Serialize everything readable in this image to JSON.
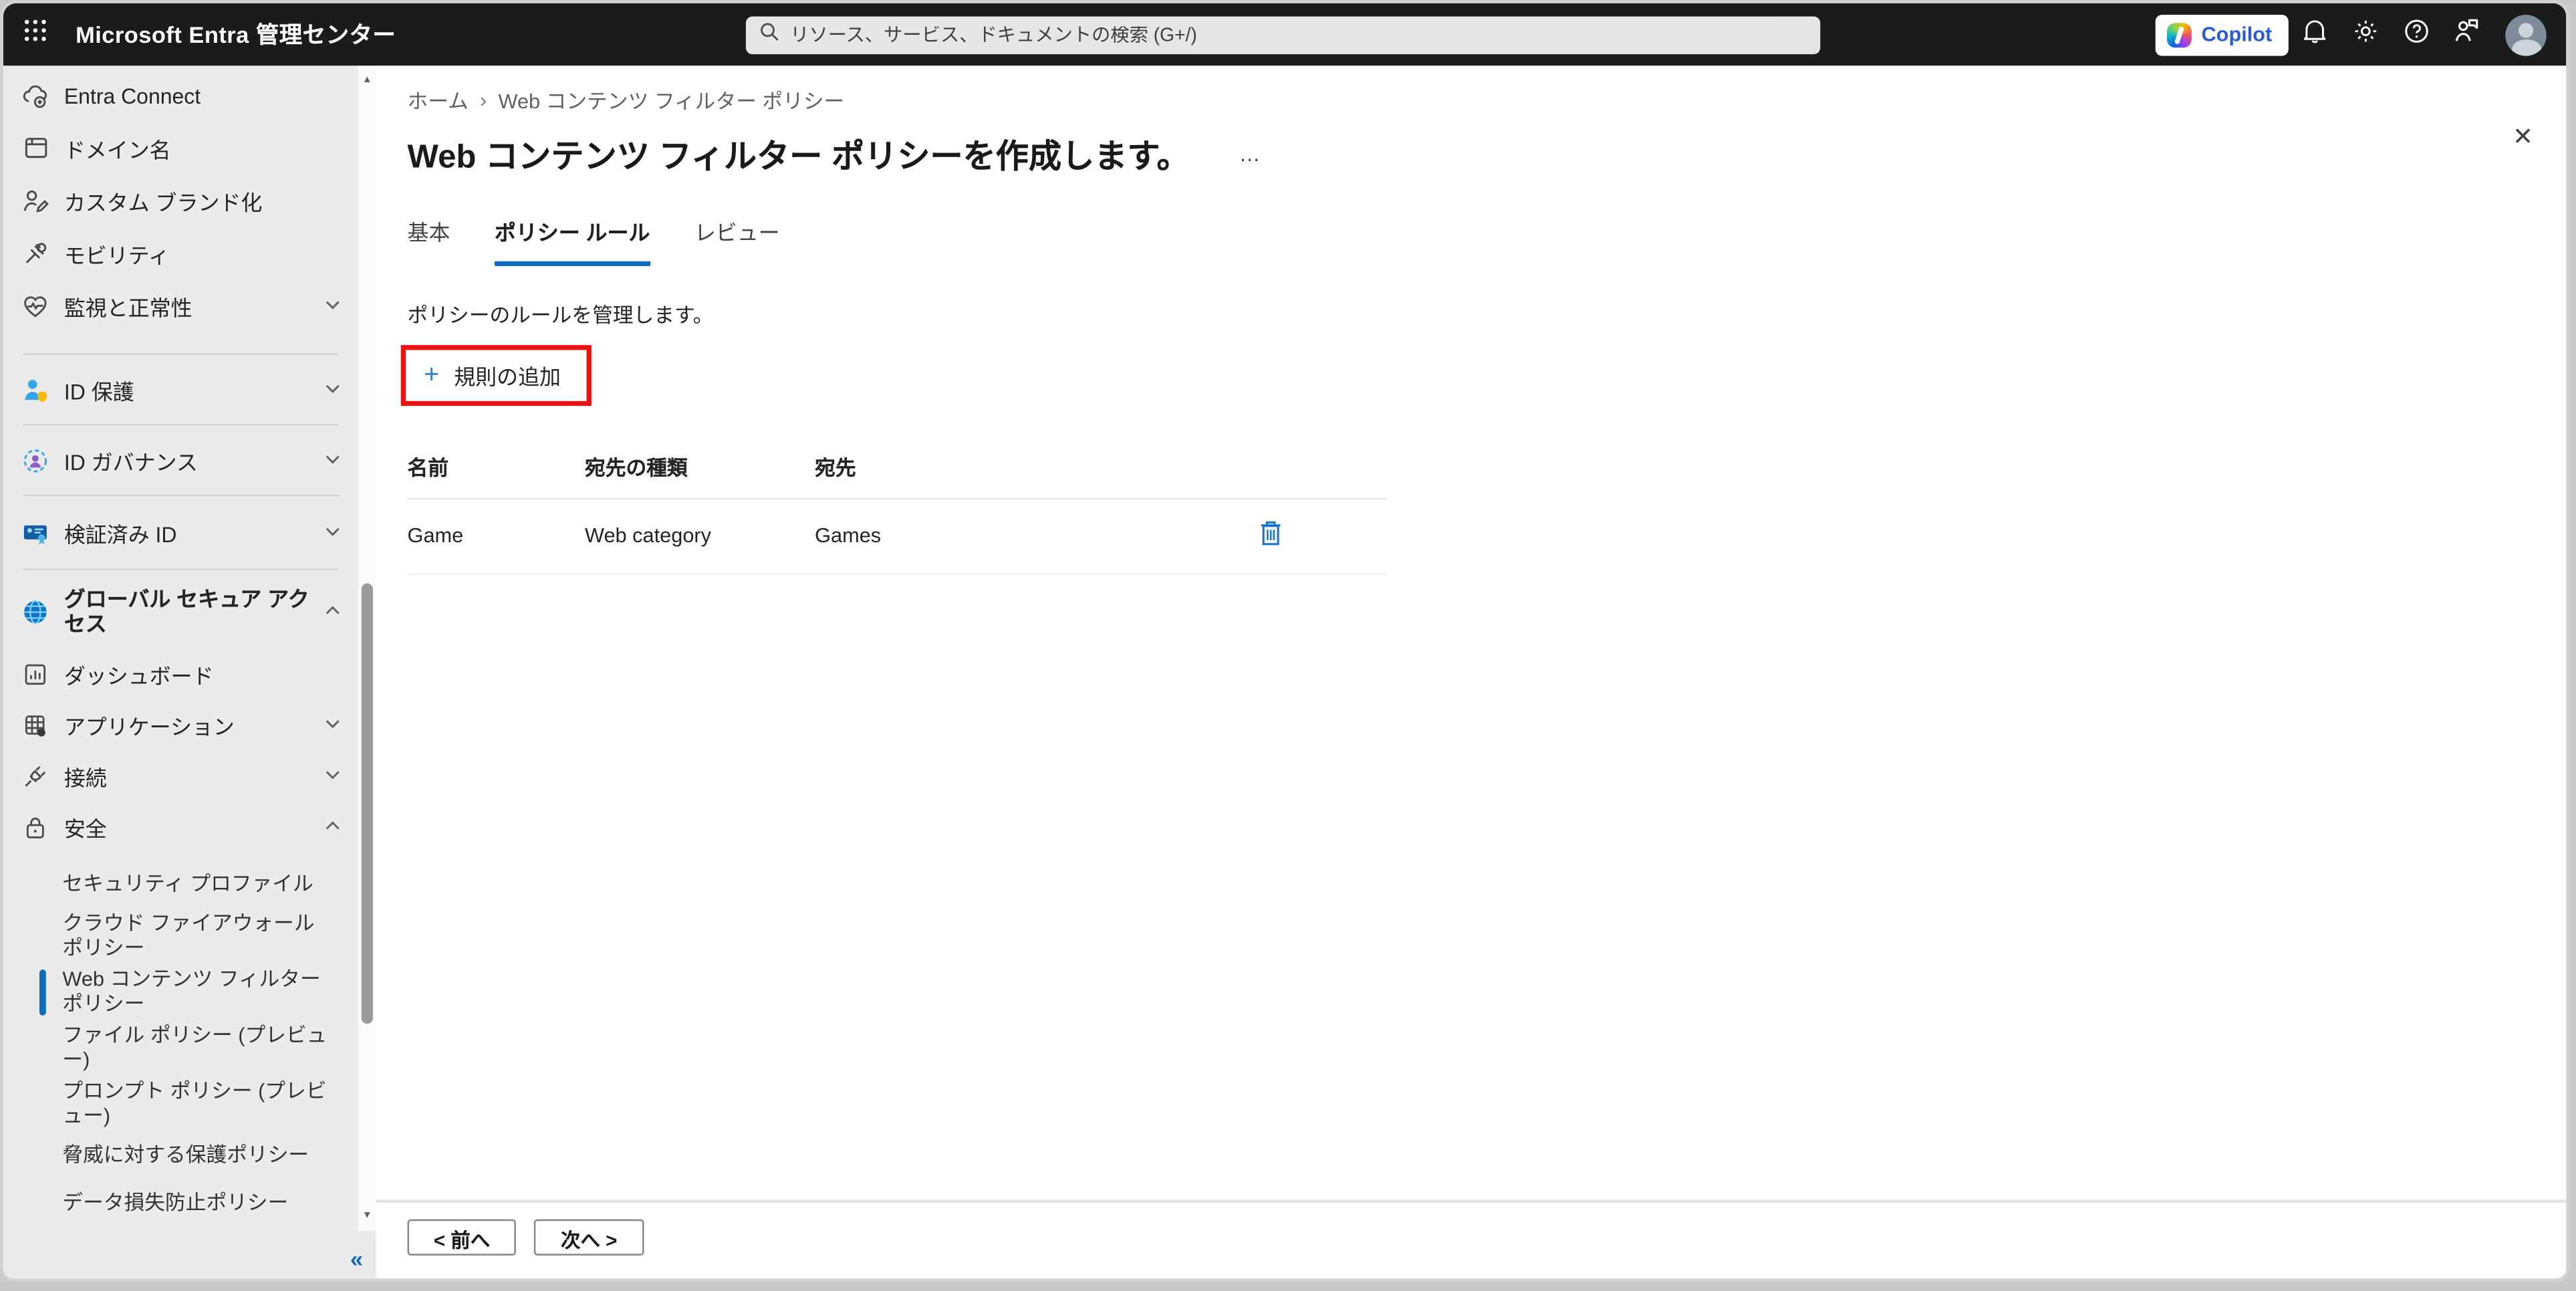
{
  "topbar": {
    "app_title": "Microsoft Entra 管理センター",
    "search_placeholder": "リソース、サービス、ドキュメントの検索 (G+/)",
    "copilot_label": "Copilot"
  },
  "icons": {
    "ellipsis": "…",
    "close": "✕",
    "breadcrumb_separator": "›",
    "plus": "+",
    "collapse": "«",
    "scroll_up": "▲",
    "scroll_down": "▼"
  },
  "sidebar": {
    "items": [
      {
        "label": "Entra Connect"
      },
      {
        "label": "ドメイン名"
      },
      {
        "label": "カスタム ブランド化"
      },
      {
        "label": "モビリティ"
      },
      {
        "label": "監視と正常性"
      },
      {
        "label": "ID 保護"
      },
      {
        "label": "ID ガバナンス"
      },
      {
        "label": "検証済み ID"
      },
      {
        "label": "グローバル セキュア アクセス"
      },
      {
        "label": "ダッシュボード"
      },
      {
        "label": "アプリケーション"
      },
      {
        "label": "接続"
      },
      {
        "label": "安全"
      },
      {
        "label": "セキュリティ プロファイル"
      },
      {
        "label": "クラウド ファイアウォール ポリシー"
      },
      {
        "label": "Web コンテンツ フィルター ポリシー",
        "selected": true
      },
      {
        "label": "ファイル ポリシー (プレビュー)"
      },
      {
        "label": "プロンプト ポリシー (プレビュー)"
      },
      {
        "label": "脅威に対する保護ポリシー"
      },
      {
        "label": "データ損失防止ポリシー"
      }
    ]
  },
  "main": {
    "breadcrumb": {
      "home": "ホーム",
      "current": "Web コンテンツ フィルター ポリシー"
    },
    "title": "Web コンテンツ フィルター ポリシーを作成します。",
    "tabs": [
      {
        "label": "基本",
        "active": false
      },
      {
        "label": "ポリシー ルール",
        "active": true
      },
      {
        "label": "レビュー",
        "active": false
      }
    ],
    "description": "ポリシーのルールを管理します。",
    "add_rule_label": "規則の追加",
    "table": {
      "columns": [
        "名前",
        "宛先の種類",
        "宛先"
      ],
      "rows": [
        {
          "name": "Game",
          "destination_type": "Web category",
          "destination": "Games"
        }
      ]
    },
    "footer": {
      "prev_label": "< 前へ",
      "next_label": "次へ >"
    }
  },
  "colors": {
    "accent": "#0f6cbd",
    "annotation_red": "#ee1111",
    "topbar_bg": "#1b1b1b",
    "sidebar_bg": "#ebebeb"
  }
}
